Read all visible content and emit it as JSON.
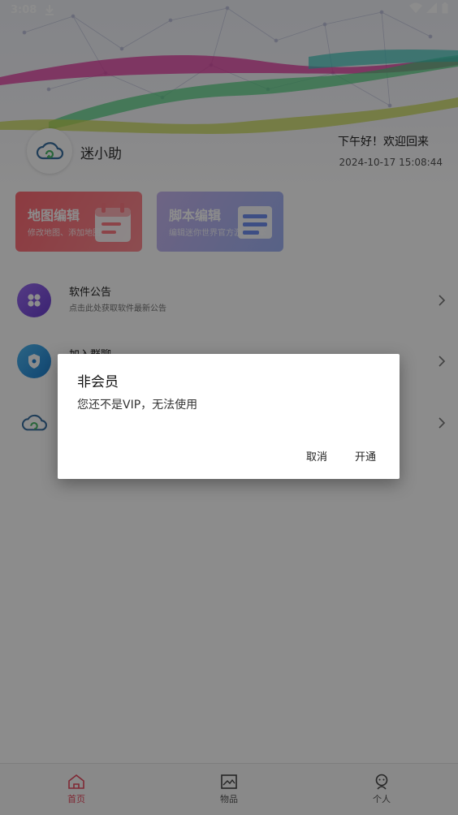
{
  "status_bar": {
    "time": "3:08",
    "icons": [
      "download-icon",
      "wifi-icon",
      "signal-icon",
      "battery-icon"
    ]
  },
  "header": {
    "app_name": "迷小助",
    "greeting": "下午好！欢迎回来",
    "datetime": "2024-10-17 15:08:44"
  },
  "cards": [
    {
      "title": "地图编辑",
      "subtitle": "修改地图、添加地图",
      "icon": "calendar-icon"
    },
    {
      "title": "脚本编辑",
      "subtitle": "编辑迷你世界官方游戏脚本",
      "icon": "document-icon"
    }
  ],
  "list": [
    {
      "title": "软件公告",
      "subtitle": "点击此处获取软件最新公告",
      "icon": "grid-icon"
    },
    {
      "title": "加入群聊",
      "subtitle": "",
      "icon": "shield-icon"
    },
    {
      "title": "",
      "subtitle": "",
      "icon": "cloud-icon"
    }
  ],
  "bottom_nav": {
    "items": [
      {
        "label": "首页",
        "icon": "home-icon",
        "active": true
      },
      {
        "label": "物品",
        "icon": "image-icon",
        "active": false
      },
      {
        "label": "个人",
        "icon": "user-icon",
        "active": false
      }
    ]
  },
  "dialog": {
    "title": "非会员",
    "message": "您还不是VIP，无法使用",
    "cancel_label": "取消",
    "confirm_label": "开通"
  },
  "colors": {
    "accent": "#e84a5f",
    "card_map": "#ff6b75",
    "card_script": "#9fb3f5",
    "overlay": "rgba(0,0,0,0.45)"
  }
}
